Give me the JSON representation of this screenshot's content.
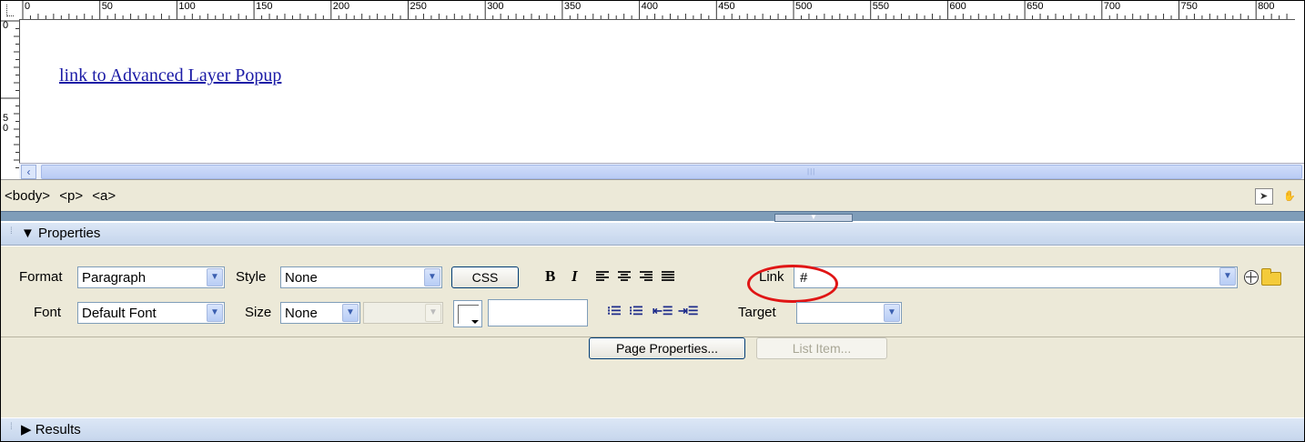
{
  "rulers": {
    "top_labels": [
      "0",
      "50",
      "100",
      "150",
      "200",
      "250",
      "300",
      "350",
      "400",
      "450",
      "500",
      "550",
      "600",
      "650",
      "700",
      "750",
      "800"
    ],
    "left_labels": [
      "0",
      "5 0"
    ]
  },
  "design": {
    "link_text": "link to Advanced Layer Popup"
  },
  "status_bar": {
    "tags": [
      "<body>",
      "<p>",
      "<a>"
    ]
  },
  "properties_panel": {
    "title": "Properties",
    "format_label": "Format",
    "format_value": "Paragraph",
    "style_label": "Style",
    "style_value": "None",
    "css_button": "CSS",
    "bold_label": "B",
    "italic_label": "I",
    "link_label": "Link",
    "link_value": "#",
    "font_label": "Font",
    "font_value": "Default Font",
    "size_label": "Size",
    "size_value": "None",
    "target_label": "Target",
    "target_value": "",
    "page_properties_button": "Page Properties...",
    "list_item_button": "List Item..."
  },
  "results_panel": {
    "title": "Results"
  },
  "colors": {
    "link": "#1a1aa6",
    "panel_bg": "#ece9d8",
    "header_blue": "#c5d5ec",
    "annotation": "#e01515"
  }
}
